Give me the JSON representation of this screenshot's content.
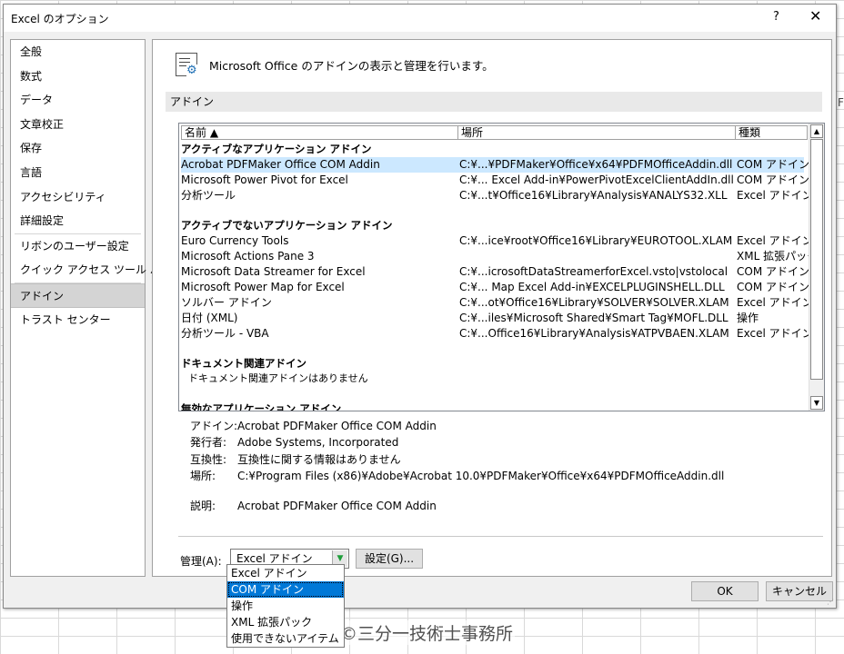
{
  "window": {
    "title": "Excel のオプション",
    "help_label": "?",
    "close_label": "✕"
  },
  "sidebar": {
    "items": [
      {
        "label": "全般"
      },
      {
        "label": "数式"
      },
      {
        "label": "データ"
      },
      {
        "label": "文章校正"
      },
      {
        "label": "保存"
      },
      {
        "label": "言語"
      },
      {
        "label": "アクセシビリティ"
      },
      {
        "label": "詳細設定"
      },
      {
        "label": "リボンのユーザー設定"
      },
      {
        "label": "クイック アクセス ツール バー"
      },
      {
        "label": "アドイン",
        "selected": true
      },
      {
        "label": "トラスト センター"
      }
    ]
  },
  "header": {
    "text": "Microsoft Office のアドインの表示と管理を行います。",
    "icon": "addin-settings-icon"
  },
  "section": {
    "title": "アドイン"
  },
  "table": {
    "columns": [
      "名前 ▲",
      "場所",
      "種類"
    ],
    "groups": [
      {
        "title": "アクティブなアプリケーション アドイン",
        "rows": [
          {
            "name": "Acrobat PDFMaker Office COM Addin",
            "location": "C:¥...¥PDFMaker¥Office¥x64¥PDFMOfficeAddin.dll",
            "type": "COM アドイン"
          },
          {
            "name": "Microsoft Power Pivot for Excel",
            "location": "C:¥... Excel Add-in¥PowerPivotExcelClientAddIn.dll",
            "type": "COM アドイン"
          },
          {
            "name": "分析ツール",
            "location": "C:¥...t¥Office16¥Library¥Analysis¥ANALYS32.XLL",
            "type": "Excel アドイン"
          }
        ]
      },
      {
        "title": "アクティブでないアプリケーション アドイン",
        "rows": [
          {
            "name": "Euro Currency Tools",
            "location": "C:¥...ice¥root¥Office16¥Library¥EUROTOOL.XLAM",
            "type": "Excel アドイン"
          },
          {
            "name": "Microsoft Actions Pane 3",
            "location": "",
            "type": "XML 拡張パック"
          },
          {
            "name": "Microsoft Data Streamer for Excel",
            "location": "C:¥...icrosoftDataStreamerforExcel.vsto|vstolocal",
            "type": "COM アドイン"
          },
          {
            "name": "Microsoft Power Map for Excel",
            "location": "C:¥... Map Excel Add-in¥EXCELPLUGINSHELL.DLL",
            "type": "COM アドイン"
          },
          {
            "name": "ソルバー アドイン",
            "location": "C:¥...ot¥Office16¥Library¥SOLVER¥SOLVER.XLAM",
            "type": "Excel アドイン"
          },
          {
            "name": "日付 (XML)",
            "location": "C:¥...iles¥Microsoft Shared¥Smart Tag¥MOFL.DLL",
            "type": "操作"
          },
          {
            "name": "分析ツール - VBA",
            "location": "C:¥...Office16¥Library¥Analysis¥ATPVBAEN.XLAM",
            "type": "Excel アドイン"
          }
        ]
      },
      {
        "title": "ドキュメント関連アドイン",
        "empty_text": "ドキュメント関連アドインはありません"
      },
      {
        "title": "無効なアプリケーション アドイン"
      }
    ]
  },
  "details": {
    "addin_label": "アドイン:",
    "addin_value": "Acrobat PDFMaker Office COM Addin",
    "publisher_label": "発行者:",
    "publisher_value": "Adobe Systems, Incorporated",
    "compat_label": "互換性:",
    "compat_value": "互換性に関する情報はありません",
    "location_label": "場所:",
    "location_value": "C:¥Program Files (x86)¥Adobe¥Acrobat 10.0¥PDFMaker¥Office¥x64¥PDFMOfficeAddin.dll",
    "desc_label": "説明:",
    "desc_value": "Acrobat PDFMaker Office COM Addin"
  },
  "manage": {
    "label": "管理(A):",
    "selected": "Excel アドイン",
    "go_button": "設定(G)...",
    "options": [
      "Excel アドイン",
      "COM アドイン",
      "操作",
      "XML 拡張パック",
      "使用できないアイテム"
    ],
    "highlighted": "COM アドイン"
  },
  "footer": {
    "ok": "OK",
    "cancel": "キャンセル"
  },
  "watermark": "©三分一技術士事務所",
  "background_edge_text": "F"
}
